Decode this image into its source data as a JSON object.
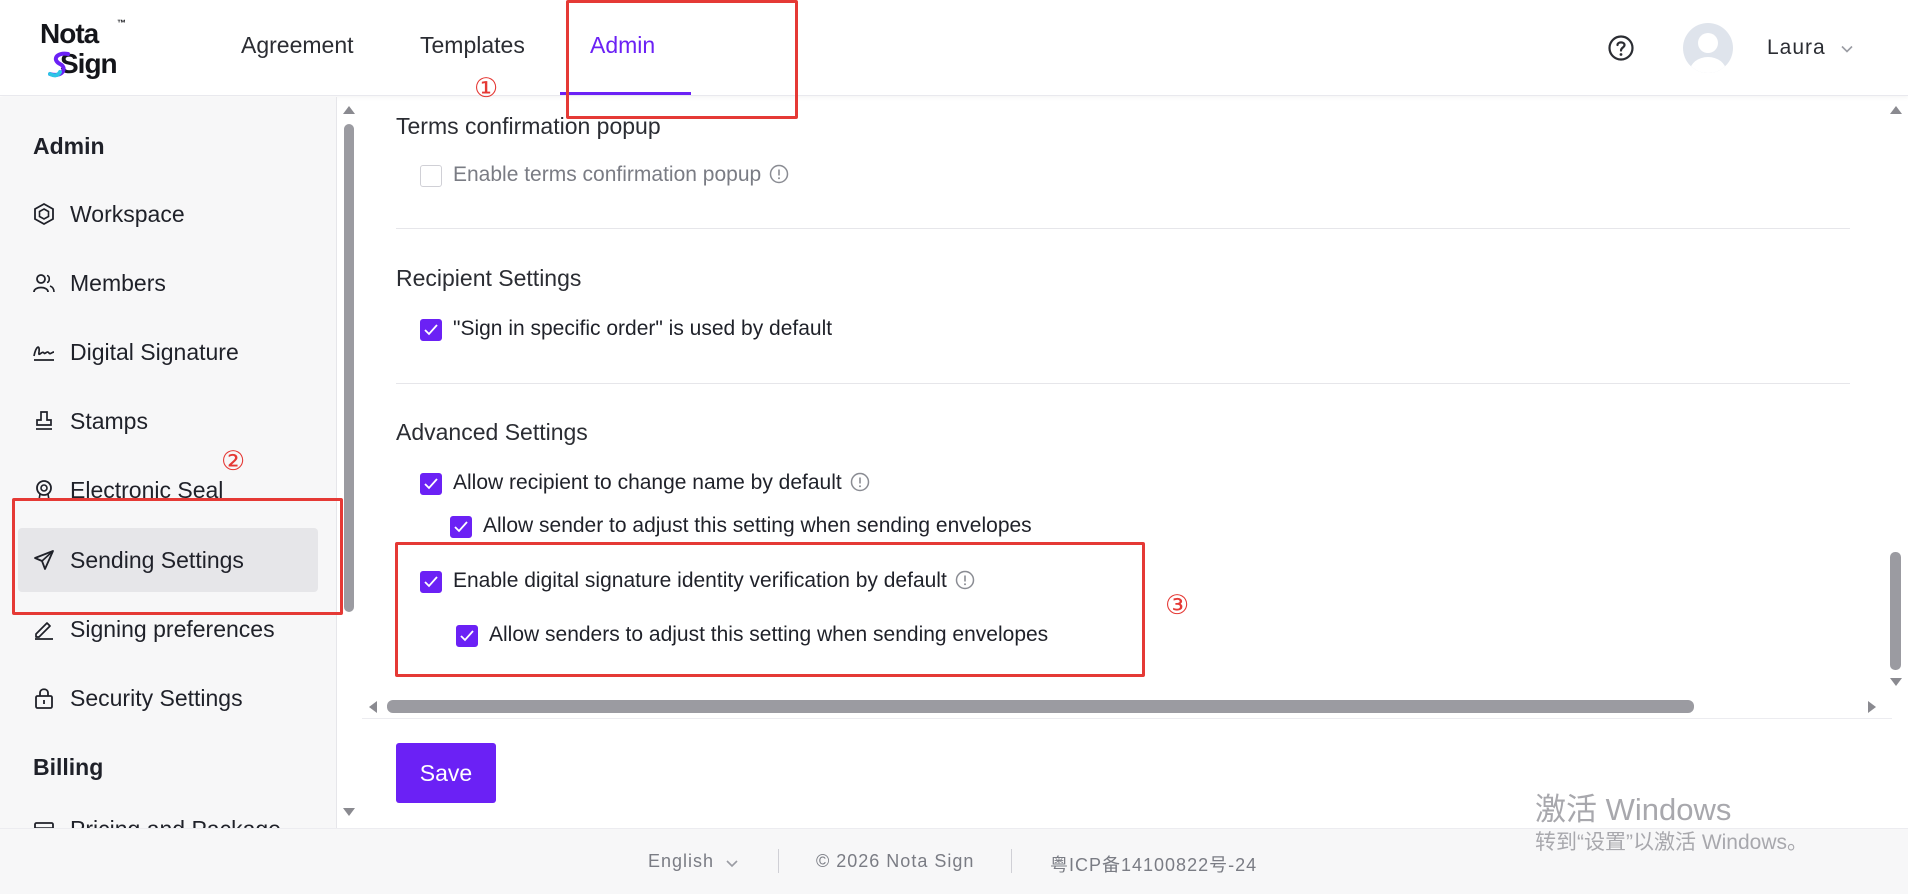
{
  "app": {
    "logo_top": "Nota",
    "logo_tm": "™",
    "logo_bottom": "Sign"
  },
  "nav": {
    "items": [
      {
        "label": "Agreement"
      },
      {
        "label": "Templates"
      },
      {
        "label": "Admin",
        "active": true
      }
    ]
  },
  "user": {
    "name": "Laura"
  },
  "sidebar": {
    "sections": [
      {
        "heading": "Admin"
      },
      {
        "heading": "Billing"
      }
    ],
    "items": [
      {
        "label": "Workspace",
        "icon": "workspace-icon"
      },
      {
        "label": "Members",
        "icon": "members-icon"
      },
      {
        "label": "Digital Signature",
        "icon": "signature-icon"
      },
      {
        "label": "Stamps",
        "icon": "stamp-icon"
      },
      {
        "label": "Electronic Seal",
        "icon": "seal-icon"
      },
      {
        "label": "Sending Settings",
        "icon": "send-icon",
        "active": true
      },
      {
        "label": "Signing preferences",
        "icon": "pen-icon"
      },
      {
        "label": "Security Settings",
        "icon": "lock-icon"
      },
      {
        "label": "Pricing and Package",
        "icon": "package-icon"
      }
    ]
  },
  "main": {
    "terms": {
      "title": "Terms confirmation popup",
      "enable_label": "Enable terms confirmation popup",
      "enable_checked": false
    },
    "recipient": {
      "title": "Recipient Settings",
      "order_label": "\"Sign in specific order\" is used by default",
      "order_checked": true
    },
    "advanced": {
      "title": "Advanced Settings",
      "change_name_label": "Allow recipient to change name by default",
      "change_name_checked": true,
      "sender_adjust_label": "Allow sender to adjust this setting when sending envelopes",
      "sender_adjust_checked": true,
      "identity_label": "Enable digital signature identity verification by default",
      "identity_checked": true,
      "senders_adjust_label": "Allow senders to adjust this setting when sending envelopes",
      "senders_adjust_checked": true
    },
    "save_label": "Save"
  },
  "footer": {
    "language": "English",
    "copyright": "© 2026 Nota Sign",
    "icp": "粤ICP备14100822号-24"
  },
  "annotations": {
    "one": "①",
    "two": "②",
    "three": "③"
  },
  "watermark": {
    "line1": "激活 Windows",
    "line2": "转到“设置”以激活 Windows。"
  },
  "colors": {
    "accent": "#6b21f5",
    "annotation": "#e53935"
  }
}
